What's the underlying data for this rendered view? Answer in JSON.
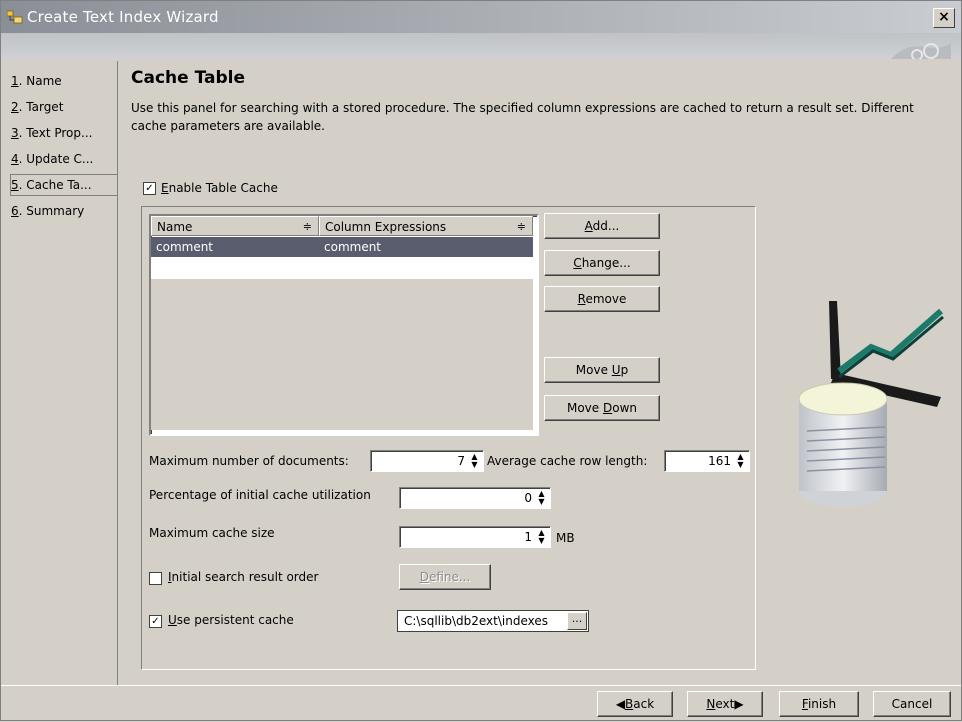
{
  "window": {
    "title": "Create Text Index Wizard",
    "close_label": "×"
  },
  "nav": {
    "items": [
      {
        "num": "1",
        "label": ". Name"
      },
      {
        "num": "2",
        "label": ". Target"
      },
      {
        "num": "3",
        "label": ". Text Prop..."
      },
      {
        "num": "4",
        "label": ". Update C..."
      },
      {
        "num": "5",
        "label": ". Cache Ta..."
      },
      {
        "num": "6",
        "label": ". Summary"
      }
    ],
    "selected_index": 4
  },
  "panel": {
    "title": "Cache Table",
    "description": "Use this panel for searching with a stored procedure. The specified column expressions are cached to return a result set. Different cache parameters are available."
  },
  "enable_cache": {
    "mnemonic": "E",
    "label": "nable Table Cache",
    "checked": true
  },
  "table": {
    "columns": [
      "Name",
      "Column Expressions"
    ],
    "rows": [
      [
        "comment",
        "comment"
      ]
    ],
    "sort_glyph": "≑"
  },
  "buttons": {
    "add": {
      "mnemonic": "A",
      "rest": "dd..."
    },
    "change": {
      "mnemonic": "C",
      "rest": "hange..."
    },
    "remove": {
      "mnemonic": "R",
      "rest": "emove"
    },
    "move_up": {
      "pre": "Move ",
      "mnemonic": "U",
      "rest": "p"
    },
    "move_down": {
      "pre": "Move ",
      "mnemonic": "D",
      "rest": "own"
    },
    "define": {
      "mnemonic": "D",
      "rest": "efine..."
    }
  },
  "fields": {
    "max_docs": {
      "label": "Maximum number of documents:",
      "value": "7"
    },
    "avg_row_len": {
      "label": "Average cache row length:",
      "value": "161"
    },
    "pct_util": {
      "label": "Percentage of initial cache utilization",
      "value": "0"
    },
    "max_size": {
      "label": "Maximum cache size",
      "value": "1",
      "unit": "MB"
    }
  },
  "initial_order": {
    "mnemonic": "I",
    "label": "nitial search result order",
    "checked": false
  },
  "persistent": {
    "mnemonic": "U",
    "label": "se persistent cache",
    "checked": true,
    "path": "C:\\sqllib\\db2ext\\indexes",
    "browse": "..."
  },
  "footer": {
    "back": {
      "mnemonic": "B",
      "rest": "ack"
    },
    "next": {
      "mnemonic": "N",
      "rest": "ext"
    },
    "finish": {
      "mnemonic": "F",
      "rest": "inish"
    },
    "cancel": "Cancel"
  },
  "colors": {
    "selection": "#5a5d6d",
    "face": "#d4d0c8"
  }
}
